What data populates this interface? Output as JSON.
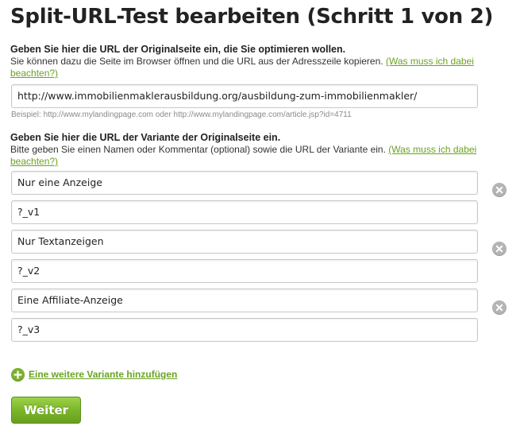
{
  "page_title": "Split-URL-Test bearbeiten (Schritt 1 von 2)",
  "original": {
    "heading": "Geben Sie hier die URL der Originalseite ein, die Sie optimieren wollen.",
    "description": "Sie können dazu die Seite im Browser öffnen und die URL aus der Adresszeile kopieren.",
    "help_link": "(Was muss ich dabei beachten?)",
    "url_value": "http://www.immobilienmaklerausbildung.org/ausbildung-zum-immobilienmakler/",
    "example": "Beispiel: http://www.mylandingpage.com oder http://www.mylandingpage.com/article.jsp?id=4711"
  },
  "variants_section": {
    "heading": "Geben Sie hier die URL der Variante der Originalseite ein.",
    "description": "Bitte geben Sie einen Namen oder Kommentar (optional) sowie die URL der Variante ein.",
    "help_link": "(Was muss ich dabei beachten?)"
  },
  "variants": [
    {
      "name": "Nur eine Anzeige",
      "url": "?_v1"
    },
    {
      "name": "Nur Textanzeigen",
      "url": "?_v2"
    },
    {
      "name": "Eine Affiliate-Anzeige",
      "url": "?_v3"
    }
  ],
  "icons": {
    "remove": "remove-circle-icon",
    "add": "add-circle-icon"
  },
  "add_variant_label": "Eine weitere Variante hinzufügen",
  "next_button_label": "Weiter",
  "colors": {
    "accent_green": "#6aa321",
    "button_green": "#7bb52a",
    "remove_grey": "#b4b4b4"
  }
}
